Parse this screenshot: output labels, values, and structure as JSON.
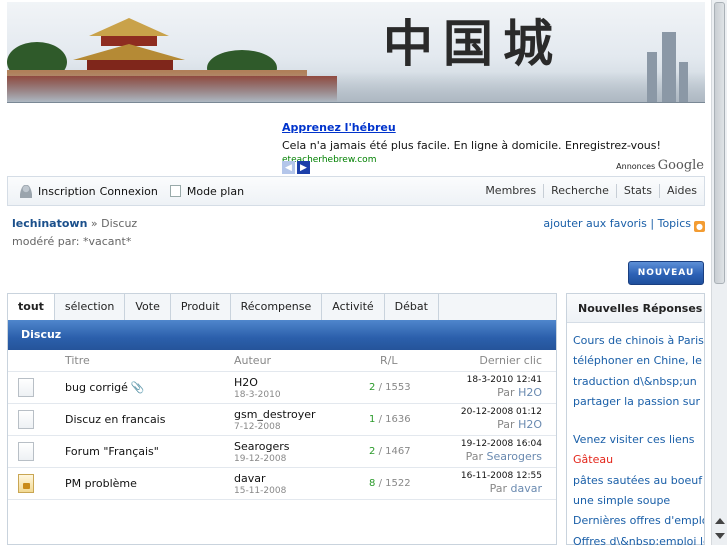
{
  "banner": {
    "calligraphy": "中国城"
  },
  "ad": {
    "title": "Apprenez l'hébreu",
    "description": "Cela n'a jamais été plus facile. En ligne à domicile. Enregistrez-vous!",
    "url": "eteacherhebrew.com",
    "credit_label": "Annonces",
    "credit_brand": "Google"
  },
  "nav": {
    "left": {
      "signup": "Inscription",
      "login": "Connexion",
      "plan_mode": "Mode plan"
    },
    "right": [
      "Membres",
      "Recherche",
      "Stats",
      "Aides"
    ]
  },
  "breadcrumb": {
    "home": "lechinatown",
    "separator": "»",
    "current": "Discuz"
  },
  "moderator": "modéré par: *vacant*",
  "favorites": {
    "add": "ajouter aux favoris",
    "sep": "|",
    "topics": "Topics"
  },
  "new_button": "NOUVEAU",
  "tabs": [
    "tout",
    "sélection",
    "Vote",
    "Produit",
    "Récompense",
    "Activité",
    "Débat"
  ],
  "forum": {
    "section_title": "Discuz",
    "columns": {
      "title": "Titre",
      "author": "Auteur",
      "rl": "R/L",
      "last": "Dernier clic"
    },
    "rows": [
      {
        "title": "bug corrigé",
        "author": "H2O",
        "date": "18-3-2010",
        "replies": "2",
        "views": "/ 1553",
        "last_time": "18-3-2010 12:41",
        "last_by_prefix": "Par",
        "last_by": "H2O",
        "attachment": "📎"
      },
      {
        "title": "Discuz en francais",
        "author": "gsm_destroyer",
        "date": "7-12-2008",
        "replies": "1",
        "views": "/ 1636",
        "last_time": "20-12-2008 01:12",
        "last_by_prefix": "Par",
        "last_by": "H2O"
      },
      {
        "title": "Forum \"Français\"",
        "author": "Searogers",
        "date": "19-12-2008",
        "replies": "2",
        "views": "/ 1467",
        "last_time": "19-12-2008 16:04",
        "last_by_prefix": "Par",
        "last_by": "Searogers"
      },
      {
        "title": "PM problème",
        "author": "davar",
        "date": "15-11-2008",
        "replies": "8",
        "views": "/ 1522",
        "last_time": "16-11-2008 12:55",
        "last_by_prefix": "Par",
        "last_by": "davar"
      }
    ]
  },
  "side": {
    "title": "Nouvelles Réponses",
    "items": [
      "Cours de chinois à Paris !",
      "téléphoner en Chine, le",
      "traduction d\\&nbsp;un",
      "partager la passion sur la",
      "",
      "Venez visiter ces liens",
      "Gâteau",
      "pâtes sautées au boeuf",
      "une simple soupe",
      "Dernières offres d'emploi",
      "Offres d\\&nbsp;emploi les"
    ]
  },
  "colors": {
    "accent": "#2b5fab",
    "link": "#1a5fa8",
    "reply_count": "#2a9a2a",
    "highlight": "#e3261b"
  }
}
